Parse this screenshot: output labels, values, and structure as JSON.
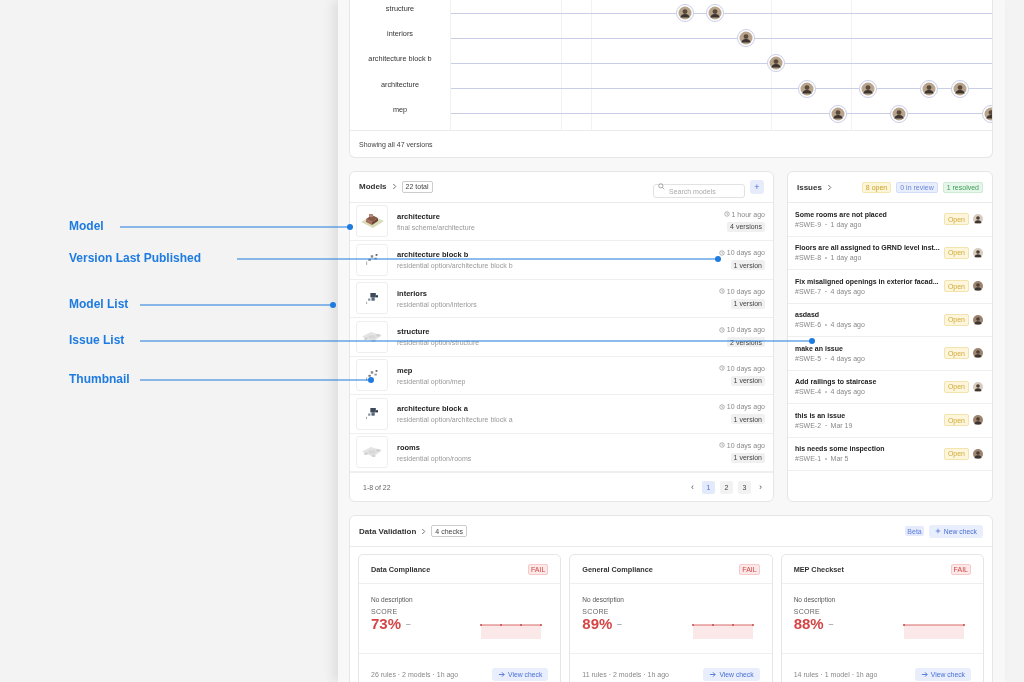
{
  "timeline": {
    "rows": [
      {
        "name": "structure"
      },
      {
        "name": "interiors"
      },
      {
        "name": "architecture block b"
      },
      {
        "name": "architecture"
      },
      {
        "name": "mep"
      }
    ],
    "footer": "Showing all 47 versions"
  },
  "models": {
    "title": "Models",
    "total": "22 total",
    "search": {
      "placeholder": "Search models"
    },
    "add_button": "+",
    "rows": [
      {
        "name": "architecture",
        "path": "final scheme/architecture",
        "updated": "1 hour ago",
        "versions": "4 versions"
      },
      {
        "name": "architecture block b",
        "path": "residential option/architecture block b",
        "updated": "10 days ago",
        "versions": "1 version"
      },
      {
        "name": "interiors",
        "path": "residential option/interiors",
        "updated": "10 days ago",
        "versions": "1 version"
      },
      {
        "name": "structure",
        "path": "residential option/structure",
        "updated": "10 days ago",
        "versions": "2 versions"
      },
      {
        "name": "mep",
        "path": "residential option/mep",
        "updated": "10 days ago",
        "versions": "1 version"
      },
      {
        "name": "architecture block a",
        "path": "residential option/architecture block a",
        "updated": "10 days ago",
        "versions": "1 version"
      },
      {
        "name": "rooms",
        "path": "residential option/rooms",
        "updated": "10 days ago",
        "versions": "1 version"
      }
    ],
    "range": "1-8 of 22",
    "prev": "‹",
    "next": "›",
    "pages": [
      {
        "label": "1",
        "selected": true
      },
      {
        "label": "2",
        "selected": false
      },
      {
        "label": "3",
        "selected": false
      }
    ]
  },
  "issues": {
    "title": "Issues",
    "counts": [
      {
        "label": "8 open",
        "kind": "open"
      },
      {
        "label": "0 in review",
        "kind": "review"
      },
      {
        "label": "1 resolved",
        "kind": "resolved"
      }
    ],
    "rows": [
      {
        "title": "Some rooms are not placed",
        "id": "#SWE-9",
        "time": "1 day ago",
        "status": "Open"
      },
      {
        "title": "Floors are all assigned to GRND level inst...",
        "id": "#SWE-8",
        "time": "1 day ago",
        "status": "Open"
      },
      {
        "title": "Fix misaligned openings in exterior facad...",
        "id": "#SWE-7",
        "time": "4 days ago",
        "status": "Open"
      },
      {
        "title": "asdasd",
        "id": "#SWE-6",
        "time": "4 days ago",
        "status": "Open"
      },
      {
        "title": "make an issue",
        "id": "#SWE-5",
        "time": "4 days ago",
        "status": "Open"
      },
      {
        "title": "Add railings to staircase",
        "id": "#SWE-4",
        "time": "4 days ago",
        "status": "Open"
      },
      {
        "title": "this is an issue",
        "id": "#SWE-2",
        "time": "Mar 19",
        "status": "Open"
      },
      {
        "title": "his needs some inspection",
        "id": "#SWE-1",
        "time": "Mar 5",
        "status": "Open"
      }
    ]
  },
  "validation": {
    "title": "Data Validation",
    "count": "4 checks",
    "beta": "Beta",
    "new_button": "New check",
    "cards": [
      {
        "title": "Data Compliance",
        "result": "FAIL",
        "description": "No description",
        "score_label": "SCORE",
        "score": "73%",
        "trend": "–",
        "meta": "26 rules · 2 models · 1h ago",
        "action": "View check"
      },
      {
        "title": "General Compliance",
        "result": "FAIL",
        "description": "No description",
        "score_label": "SCORE",
        "score": "89%",
        "trend": "–",
        "meta": "11 rules · 2 models · 1h ago",
        "action": "View check"
      },
      {
        "title": "MEP Checkset",
        "result": "FAIL",
        "description": "No description",
        "score_label": "SCORE",
        "score": "88%",
        "trend": "–",
        "meta": "14 rules · 1 model · 1h ago",
        "action": "View check"
      }
    ]
  },
  "callouts": [
    {
      "label": "Model"
    },
    {
      "label": "Version Last Published"
    },
    {
      "label": "Model List"
    },
    {
      "label": "Issue List"
    },
    {
      "label": "Thumbnail"
    }
  ]
}
